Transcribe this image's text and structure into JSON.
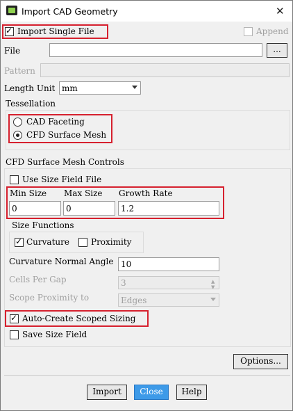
{
  "window": {
    "title": "Import CAD Geometry",
    "close_glyph": "✕",
    "app_icon": "cad-app-icon"
  },
  "import_single_file": {
    "label": "Import Single File",
    "checked": true
  },
  "append": {
    "label": "Append",
    "checked": false,
    "enabled": false
  },
  "file": {
    "label": "File",
    "value": "",
    "browse_label": "..."
  },
  "pattern": {
    "label": "Pattern",
    "value": ""
  },
  "length_unit": {
    "label": "Length Unit",
    "value": "mm"
  },
  "tessellation": {
    "label": "Tessellation",
    "options": [
      {
        "label": "CAD Faceting",
        "selected": false
      },
      {
        "label": "CFD Surface Mesh",
        "selected": true
      }
    ]
  },
  "cfd_controls": {
    "label": "CFD Surface Mesh Controls",
    "use_size_field_file": {
      "label": "Use Size Field File",
      "checked": false
    },
    "min_size": {
      "label": "Min Size",
      "value": "0"
    },
    "max_size": {
      "label": "Max Size",
      "value": "0"
    },
    "growth_rate": {
      "label": "Growth Rate",
      "value": "1.2"
    },
    "size_functions": {
      "label": "Size Functions",
      "curvature": {
        "label": "Curvature",
        "checked": true
      },
      "proximity": {
        "label": "Proximity",
        "checked": false
      }
    },
    "curvature_normal_angle": {
      "label": "Curvature Normal Angle",
      "value": "10"
    },
    "cells_per_gap": {
      "label": "Cells Per Gap",
      "value": "3"
    },
    "scope_proximity_to": {
      "label": "Scope Proximity to",
      "value": "Edges"
    },
    "auto_create_scoped_sizing": {
      "label": "Auto-Create Scoped Sizing",
      "checked": true
    },
    "save_size_field": {
      "label": "Save Size Field",
      "checked": false
    }
  },
  "buttons": {
    "options": "Options...",
    "import": "Import",
    "close": "Close",
    "help": "Help"
  },
  "colors": {
    "highlight_box": "#d6202e",
    "close_button": "#3d9ae8",
    "window_bg": "#f0f0f0"
  }
}
